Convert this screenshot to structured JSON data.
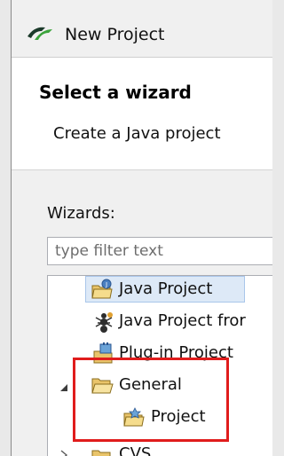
{
  "window": {
    "title": "New Project"
  },
  "header": {
    "title": "Select a wizard",
    "description": "Create a Java project"
  },
  "wizards": {
    "label": "Wizards:",
    "filter_placeholder": "type filter text"
  },
  "tree": {
    "items": [
      {
        "label": "Java Project",
        "icon": "java-project-icon",
        "selected": true
      },
      {
        "label": "Java Project fror",
        "icon": "java-project-from-ant-icon"
      },
      {
        "label": "Plug-in Project",
        "icon": "plugin-project-icon"
      },
      {
        "label": "General",
        "icon": "folder-open-icon",
        "expanded": true
      },
      {
        "label": "Project",
        "icon": "project-folder-icon"
      },
      {
        "label": "CVS",
        "icon": "folder-icon"
      }
    ]
  },
  "colors": {
    "highlight": "#e01c1c",
    "selection": "#dde9f7"
  }
}
